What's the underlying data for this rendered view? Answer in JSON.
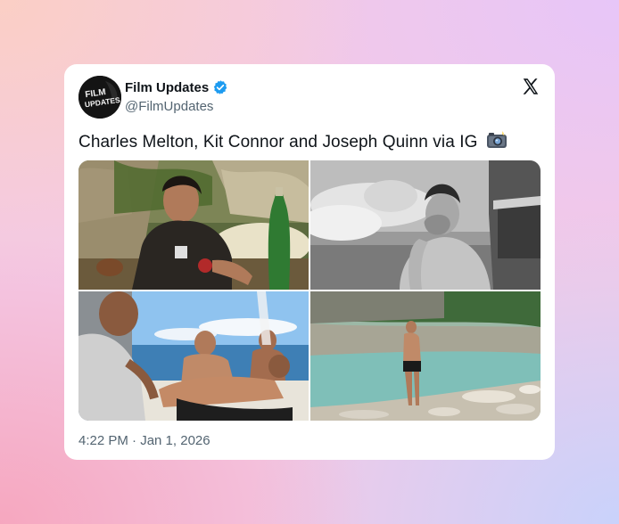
{
  "tweet": {
    "author_name": "Film Updates",
    "author_handle": "@FilmUpdates",
    "avatar_text_line1": "FILM",
    "avatar_text_line2": "UPDATES",
    "text": "Charles Melton, Kit Connor and Joseph Quinn via IG",
    "emoji": "camera-with-flash",
    "timestamp": "4:22 PM · Jan 1, 2026",
    "verified_color": "#1d9bf0"
  },
  "photos": [
    {
      "name": "photo-man-at-table-outdoor"
    },
    {
      "name": "photo-man-lighting-cigarette-bw"
    },
    {
      "name": "photo-friends-on-boat"
    },
    {
      "name": "photo-man-on-riverbank"
    }
  ],
  "icons": {
    "platform": "x-logo-icon",
    "verified": "verified-badge-icon"
  }
}
